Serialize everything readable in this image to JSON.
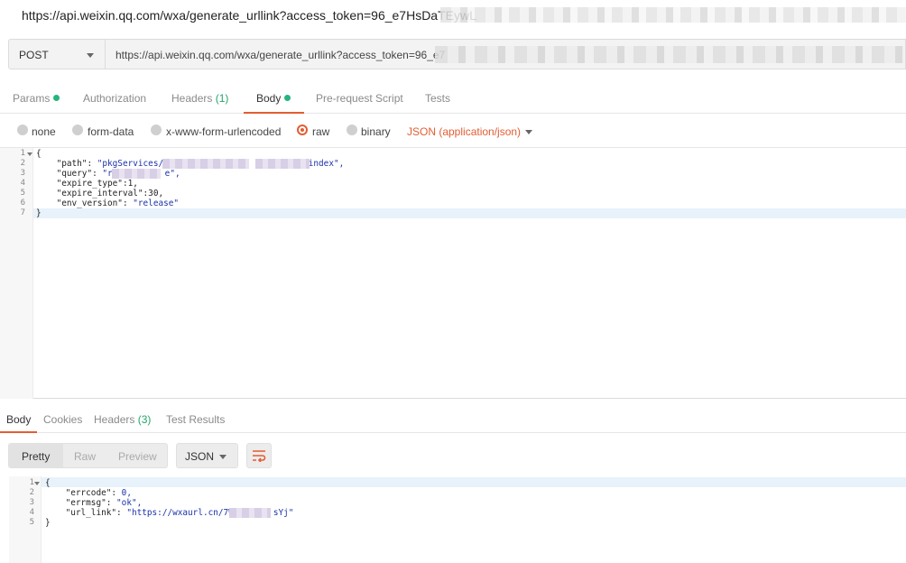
{
  "window": {
    "title": "https://api.weixin.qq.com/wxa/generate_urllink?access_token=96_e7HsDaTEywL"
  },
  "request": {
    "method": "POST",
    "url": "https://api.weixin.qq.com/wxa/generate_urllink?access_token=96_e7"
  },
  "tabs": {
    "params": "Params",
    "authorization": "Authorization",
    "headers": "Headers",
    "headers_count": "(1)",
    "body": "Body",
    "prerequest": "Pre-request Script",
    "tests": "Tests"
  },
  "body_types": {
    "none": "none",
    "form_data": "form-data",
    "urlencoded": "x-www-form-urlencoded",
    "raw": "raw",
    "binary": "binary",
    "content_type": "JSON (application/json)"
  },
  "request_body": {
    "line_numbers": [
      "1",
      "2",
      "3",
      "4",
      "5",
      "6",
      "7"
    ],
    "l1": "{",
    "l2_key": "    \"path\": ",
    "l2_val_a": "\"pkgServices/",
    "l2_val_b": "/index\",",
    "l3_key": "    \"query\": ",
    "l3_val_a": "\"r",
    "l3_val_b": "e\",",
    "l4": "    \"expire_type\":1,",
    "l5": "    \"expire_interval\":30,",
    "l6_key": "    \"env_version\": ",
    "l6_val": "\"release\"",
    "l7": "}"
  },
  "response_tabs": {
    "body": "Body",
    "cookies": "Cookies",
    "headers": "Headers",
    "headers_count": "(3)",
    "test_results": "Test Results"
  },
  "response_toolbar": {
    "pretty": "Pretty",
    "raw": "Raw",
    "preview": "Preview",
    "format": "JSON"
  },
  "response_body": {
    "line_numbers": [
      "1",
      "2",
      "3",
      "4",
      "5"
    ],
    "l1": "{",
    "l2_key": "    \"errcode\": ",
    "l2_val": "0,",
    "l3_key": "    \"errmsg\": ",
    "l3_val": "\"ok\",",
    "l4_key": "    \"url_link\": ",
    "l4_val_a": "\"https://wxaurl.cn/7W",
    "l4_val_b": "sYj\"",
    "l5": "}"
  },
  "colors": {
    "accent": "#e25d33",
    "status_dot": "#26b47f",
    "string": "#1b32a8"
  }
}
